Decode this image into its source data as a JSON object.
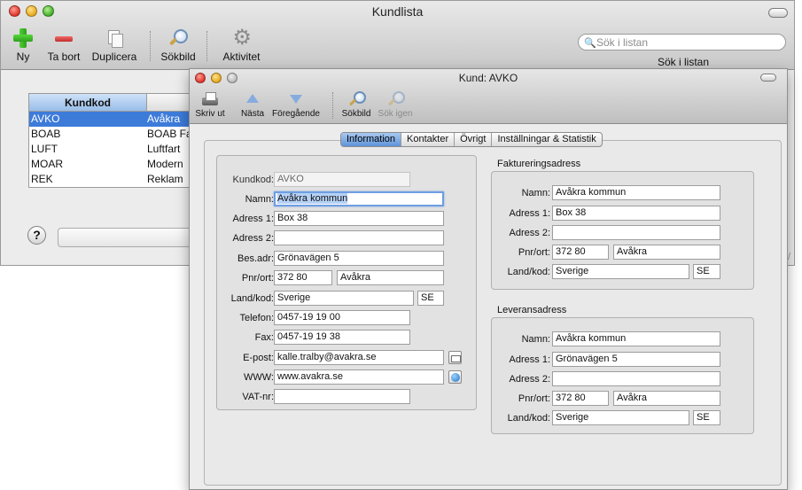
{
  "back_window": {
    "title": "Kundlista",
    "toolbar": {
      "new": "Ny",
      "delete": "Ta bort",
      "duplicate": "Duplicera",
      "search_image": "Sökbild",
      "activity": "Aktivitet"
    },
    "search": {
      "placeholder": "Sök i listan",
      "caption": "Sök i listan"
    },
    "list": {
      "header": "Kundkod",
      "rows": [
        {
          "code": "AVKO",
          "name": "Avåkra",
          "selected": true
        },
        {
          "code": "BOAB",
          "name": "BOAB Fa",
          "selected": false
        },
        {
          "code": "LUFT",
          "name": "Luftfart",
          "selected": false
        },
        {
          "code": "MOAR",
          "name": "Modern",
          "selected": false
        },
        {
          "code": "REK",
          "name": "Reklam",
          "selected": false
        }
      ]
    },
    "help": "?"
  },
  "front_window": {
    "title": "Kund: AVKO",
    "toolbar": {
      "print": "Skriv ut",
      "next": "Nästa",
      "previous": "Föregående",
      "search_image": "Sökbild",
      "search_again": "Sök igen"
    },
    "tabs": [
      "Information",
      "Kontakter",
      "Övrigt",
      "Inställningar & Statistik"
    ],
    "active_tab": "Information",
    "info": {
      "labels": {
        "code": "Kundkod:",
        "name": "Namn:",
        "address1": "Adress 1:",
        "address2": "Adress 2:",
        "visit_address": "Bes.adr:",
        "zip_city": "Pnr/ort:",
        "country_code": "Land/kod:",
        "phone": "Telefon:",
        "fax": "Fax:",
        "email": "E-post:",
        "www": "WWW:",
        "vat": "VAT-nr:"
      },
      "values": {
        "code": "AVKO",
        "name": "Avåkra kommun",
        "address1": "Box 38",
        "address2": "",
        "visit_address": "Grönavägen 5",
        "zip": "372 80",
        "city": "Avåkra",
        "country": "Sverige",
        "country_code": "SE",
        "phone": "0457-19 19 00",
        "fax": "0457-19 19 38",
        "email": "kalle.tralby@avakra.se",
        "www": "www.avakra.se",
        "vat": ""
      }
    },
    "billing": {
      "title": "Faktureringsadress",
      "labels": {
        "name": "Namn:",
        "address1": "Adress 1:",
        "address2": "Adress 2:",
        "zip_city": "Pnr/ort:",
        "country_code": "Land/kod:"
      },
      "values": {
        "name": "Avåkra kommun",
        "address1": "Box 38",
        "address2": "",
        "zip": "372 80",
        "city": "Avåkra",
        "country": "Sverige",
        "country_code": "SE"
      }
    },
    "delivery": {
      "title": "Leveransadress",
      "labels": {
        "name": "Namn:",
        "address1": "Adress 1:",
        "address2": "Adress 2:",
        "zip_city": "Pnr/ort:",
        "country_code": "Land/kod:"
      },
      "values": {
        "name": "Avåkra kommun",
        "address1": "Grönavägen 5",
        "address2": "",
        "zip": "372 80",
        "city": "Avåkra",
        "country": "Sverige",
        "country_code": "SE"
      }
    }
  }
}
